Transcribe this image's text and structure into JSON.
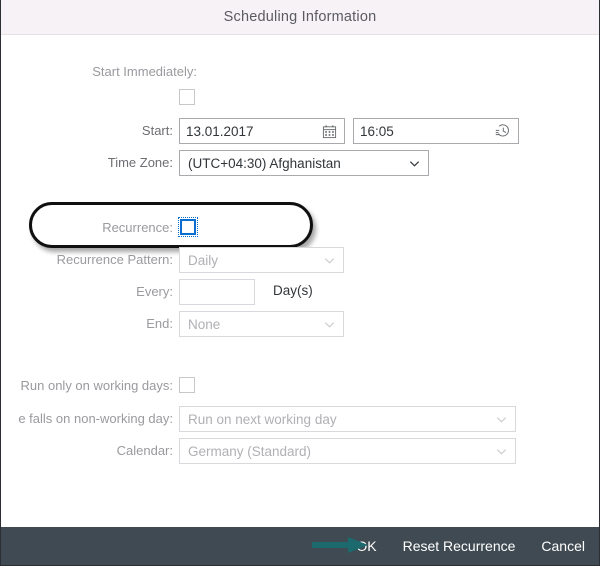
{
  "header": {
    "title": "Scheduling Information"
  },
  "form": {
    "start_immediately": {
      "label": "Start Immediately:",
      "checked": false,
      "icon": "checkbox-icon"
    },
    "start": {
      "label": "Start:",
      "date_value": "13.01.2017",
      "date_icon": "calendar-icon",
      "time_value": "16:05",
      "time_icon": "clock-history-icon"
    },
    "time_zone": {
      "label": "Time Zone:",
      "value": "(UTC+04:30) Afghanistan",
      "icon": "chevron-down-icon"
    },
    "recurrence": {
      "label": "Recurrence:",
      "checked": false,
      "focused": true,
      "icon": "checkbox-icon"
    },
    "recurrence_pattern": {
      "label": "Recurrence Pattern:",
      "value": "Daily",
      "icon": "chevron-down-icon"
    },
    "every": {
      "label": "Every:",
      "value": "",
      "unit": "Day(s)"
    },
    "end": {
      "label": "End:",
      "value": "None",
      "icon": "chevron-down-icon"
    },
    "run_only_working_days": {
      "label": "Run only on working days:",
      "checked": false,
      "icon": "checkbox-icon"
    },
    "non_working_day": {
      "label": "e falls on non-working day:",
      "value": "Run on next working day",
      "icon": "chevron-down-icon"
    },
    "calendar": {
      "label": "Calendar:",
      "value": "Germany (Standard)",
      "icon": "chevron-down-icon"
    }
  },
  "annotations": {
    "highlight_oval": "recurrence-row",
    "pointer_arrow": "ok-button",
    "arrow_color": "#1d6a6e",
    "oval_color": "#101010"
  },
  "footer": {
    "ok_label": "OK",
    "reset_label": "Reset Recurrence",
    "cancel_label": "Cancel",
    "background": "#3f4a52"
  }
}
